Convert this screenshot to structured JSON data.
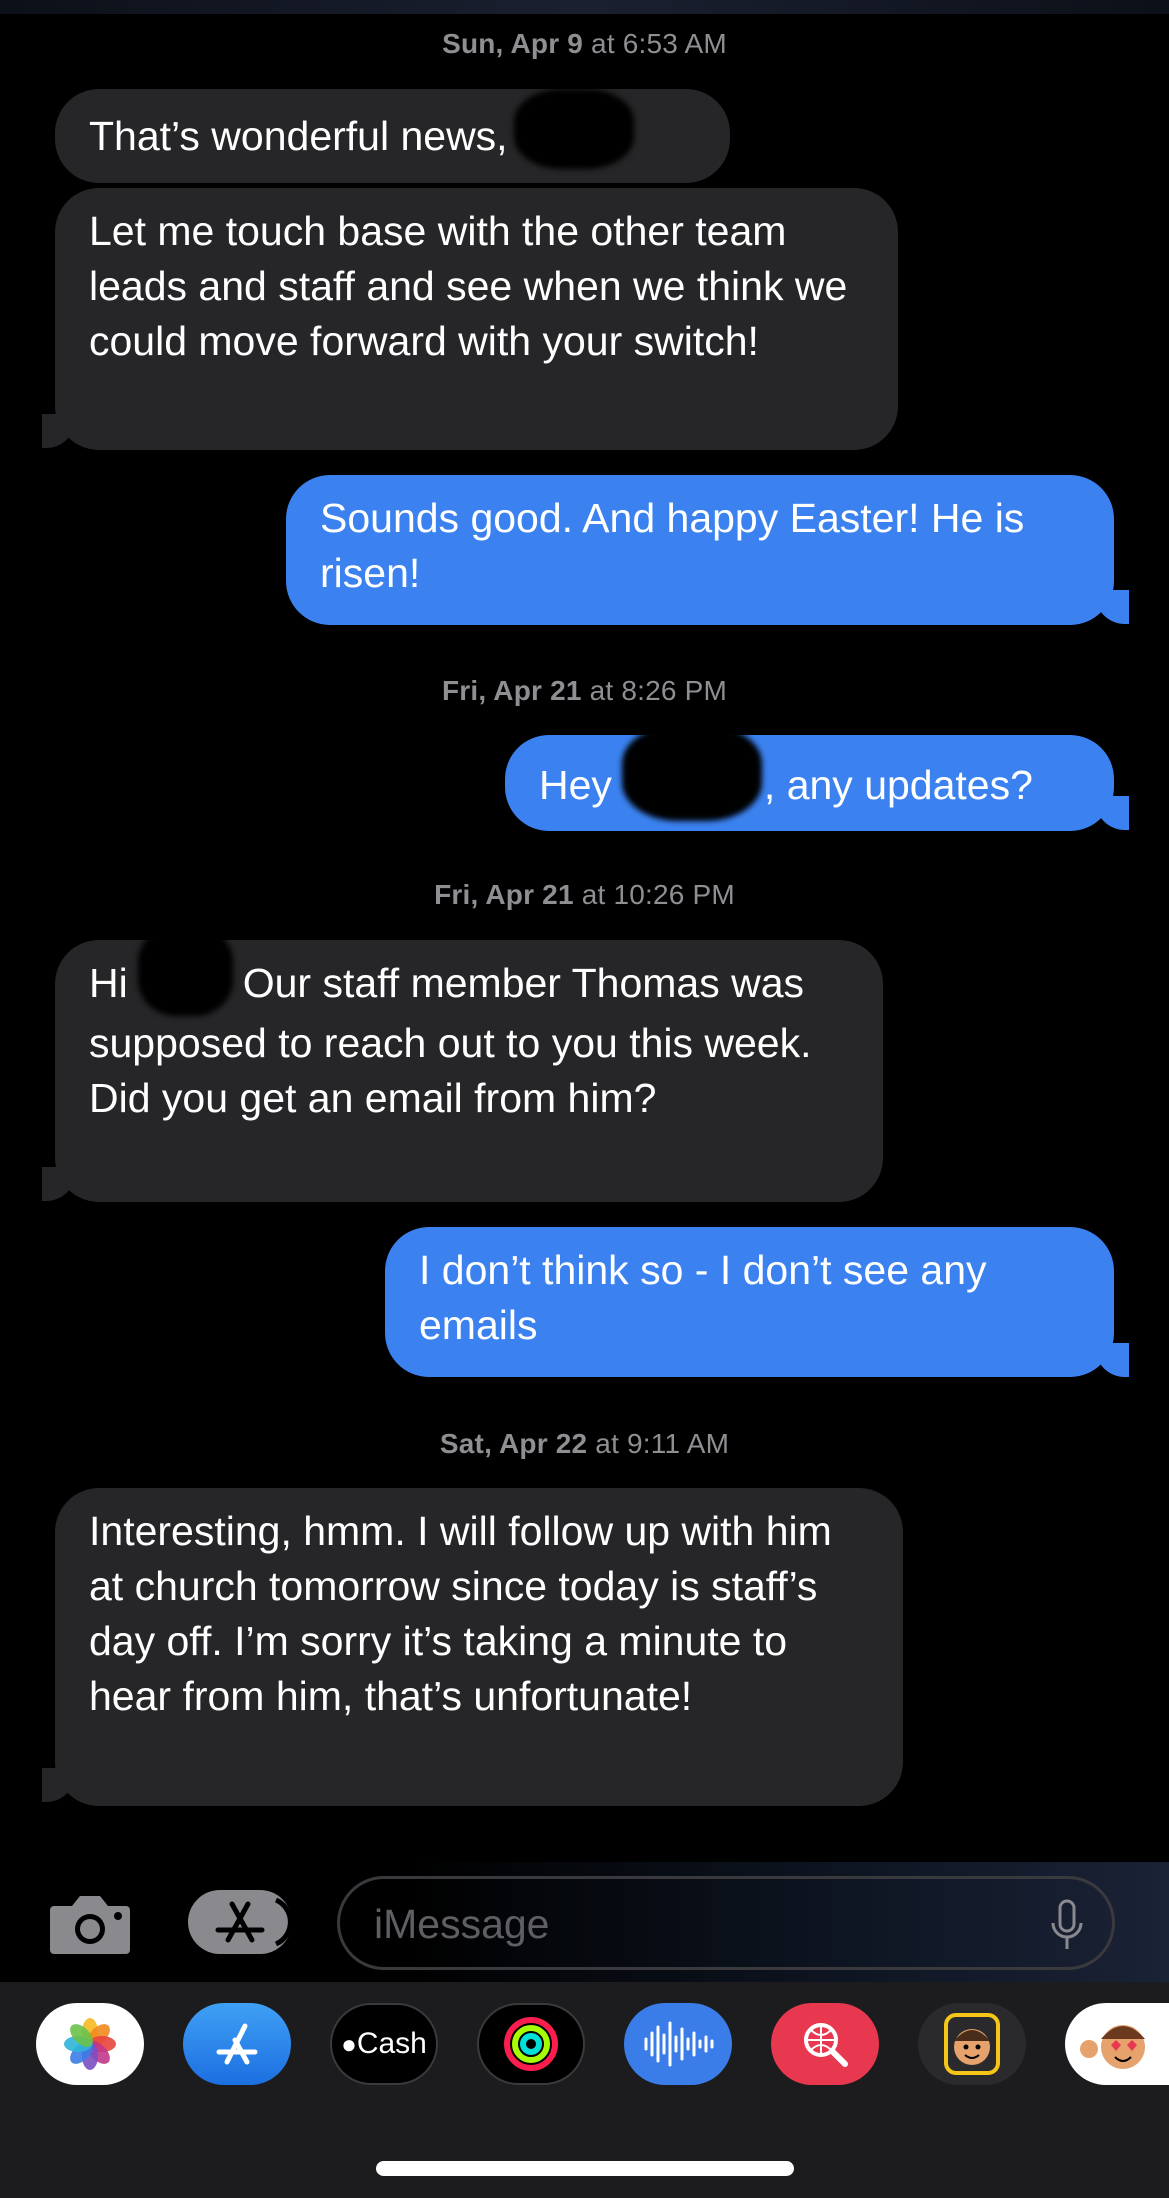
{
  "timestamps": [
    {
      "day": "Sun, Apr 9",
      "time": " at 6:53 AM"
    },
    {
      "day": "Fri, Apr 21",
      "time": " at 8:26 PM"
    },
    {
      "day": "Fri, Apr 21",
      "time": " at 10:26 PM"
    },
    {
      "day": "Sat, Apr 22",
      "time": " at 9:11 AM"
    }
  ],
  "messages": [
    {
      "text": "That’s wonderful news,"
    },
    {
      "text": "Let me touch base with the other team leads and staff and see when we think we could move forward with your switch!"
    },
    {
      "text": "Sounds good. And happy Easter! He is risen!"
    },
    {
      "pre": "Hey",
      "post": ", any updates?"
    },
    {
      "pre": "Hi",
      "post": "Our staff member Thomas was supposed to reach out to you this week. Did you get an email from him?"
    },
    {
      "text": "I don’t think so - I don’t see any emails"
    },
    {
      "text": "Interesting, hmm. I will follow up with him at church tomorrow since today is staff’s day off. I’m sorry it’s taking a minute to hear from him, that’s unfortunate!"
    }
  ],
  "composer": {
    "placeholder": "iMessage"
  },
  "app_tray": {
    "cash_label": "Cash",
    "apps": [
      "photos-icon",
      "app-store-icon",
      "apple-cash-icon",
      "activity-icon",
      "soundhound-icon",
      "image-search-icon",
      "memoji-icon",
      "memoji-stickers-icon"
    ]
  },
  "colors": {
    "incoming_bubble": "#262628",
    "outgoing_bubble": "#3b82f0",
    "background": "#000000",
    "timestamp": "#8e8e93"
  }
}
